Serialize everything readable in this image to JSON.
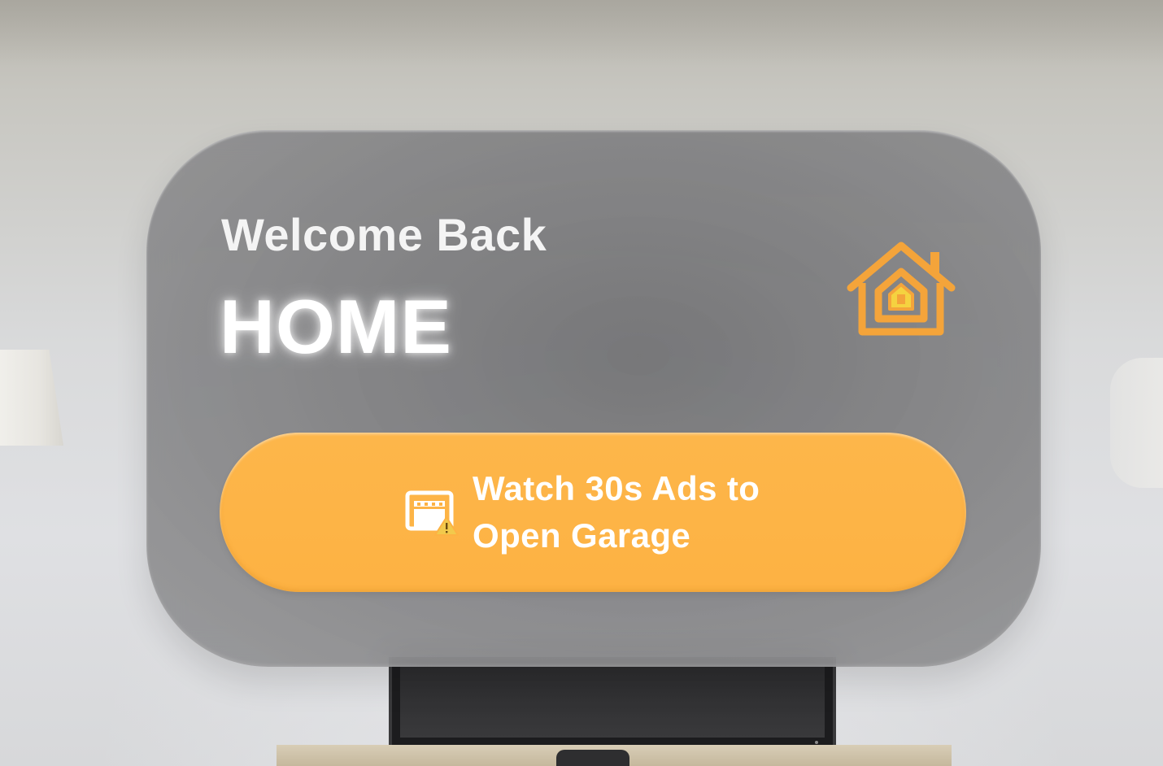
{
  "panel": {
    "greeting": "Welcome Back",
    "title": "HOME",
    "home_icon": "house-icon"
  },
  "action_button": {
    "icon": "garage-warning-icon",
    "label": "Watch 30s Ads to Open Garage"
  },
  "colors": {
    "accent": "#fdb243",
    "icon_orange": "#f4a43a",
    "icon_yellow": "#f5d240",
    "panel_gray": "#7d7d7f"
  }
}
